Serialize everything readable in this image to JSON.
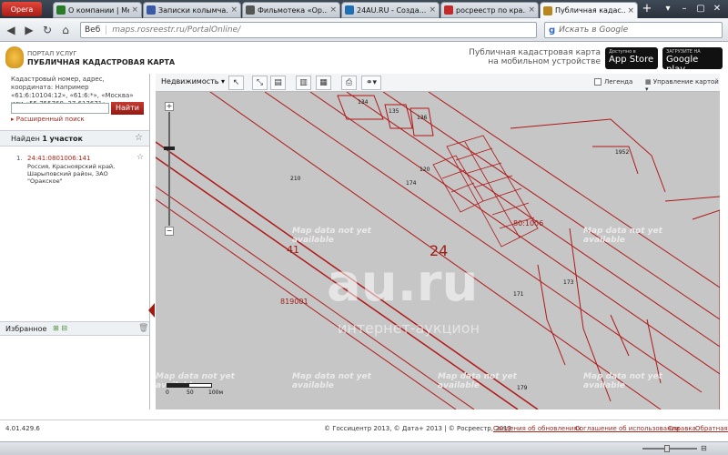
{
  "browser": {
    "opera_label": "Opera",
    "tabs": [
      {
        "label": "О компании | Ме...",
        "color": "#2a7a2a"
      },
      {
        "label": "Записки колымча...",
        "color": "#3a5aa8"
      },
      {
        "label": "Фильмотека «Ор...",
        "color": "#555555"
      },
      {
        "label": "24AU.RU - Созда...",
        "color": "#1f6fb2"
      },
      {
        "label": "росреестр по кра...",
        "color": "#c22b2b"
      },
      {
        "label": "Публичная кадас...",
        "color": "#b8861b"
      }
    ],
    "new_tab": "+",
    "address": {
      "web_label": "Веб",
      "url": "maps.rosreestr.ru/PortalOnline/"
    },
    "search": {
      "engine": "g",
      "placeholder": "Искать в Google"
    }
  },
  "portal": {
    "line1": "ПОРТАЛ УСЛУГ",
    "line2": "ПУБЛИЧНАЯ КАДАСТРОВАЯ КАРТА",
    "mobile_text_1": "Публичная кадастровая карта",
    "mobile_text_2": "на мобильном устройстве",
    "appstore_small": "Доступно в",
    "appstore_big": "App Store",
    "gplay_small": "ЗАГРУЗИТЕ НА",
    "gplay_big": "Google play"
  },
  "sidebar": {
    "search_hint": "Кадастровый номер, адрес, координата: Например «61:6:10104:12», «61:6:*», «Москва» или «55.755768, 37.617671»",
    "search_button": "Найти",
    "advanced_search": "Расширенный поиск",
    "found_prefix": "Найден",
    "found_count": "1",
    "found_suffix": "участок",
    "result": {
      "num": "1.",
      "cadastral_number": "24:41:0801006:141",
      "address": "Россия, Красноярский край, Шарыповский район, ЗАО \"Оракское\""
    },
    "favorites": "Избранное"
  },
  "toolbar": {
    "layer": "Недвижимость",
    "legend": "Легенда",
    "management": "Управление картой"
  },
  "map": {
    "no_data": "Map data not yet available",
    "region": "24",
    "district": "41",
    "quarter1": "819001",
    "quarter2": "80:1006",
    "watermark": "au.ru",
    "watermark_sub": "интернет-аукцион",
    "parcels": [
      "134",
      "135",
      "136",
      "120",
      "174",
      "210",
      "171",
      "172",
      "173",
      "1952",
      "179"
    ],
    "scale": {
      "zero": "0",
      "mid": "50",
      "end": "100м"
    }
  },
  "footer": {
    "version": "4.01.429.6",
    "copyright": "© Госсицентр 2013, © Дата+ 2013 | © Росреестр, 2013",
    "links": [
      "Сведения об обновлениях",
      "Соглашение об использовании",
      "Справка",
      "Обратная связь"
    ]
  },
  "colors": {
    "accent": "#a0281e",
    "map_bg": "#c6c6c6",
    "parcel_line": "#b01818"
  }
}
